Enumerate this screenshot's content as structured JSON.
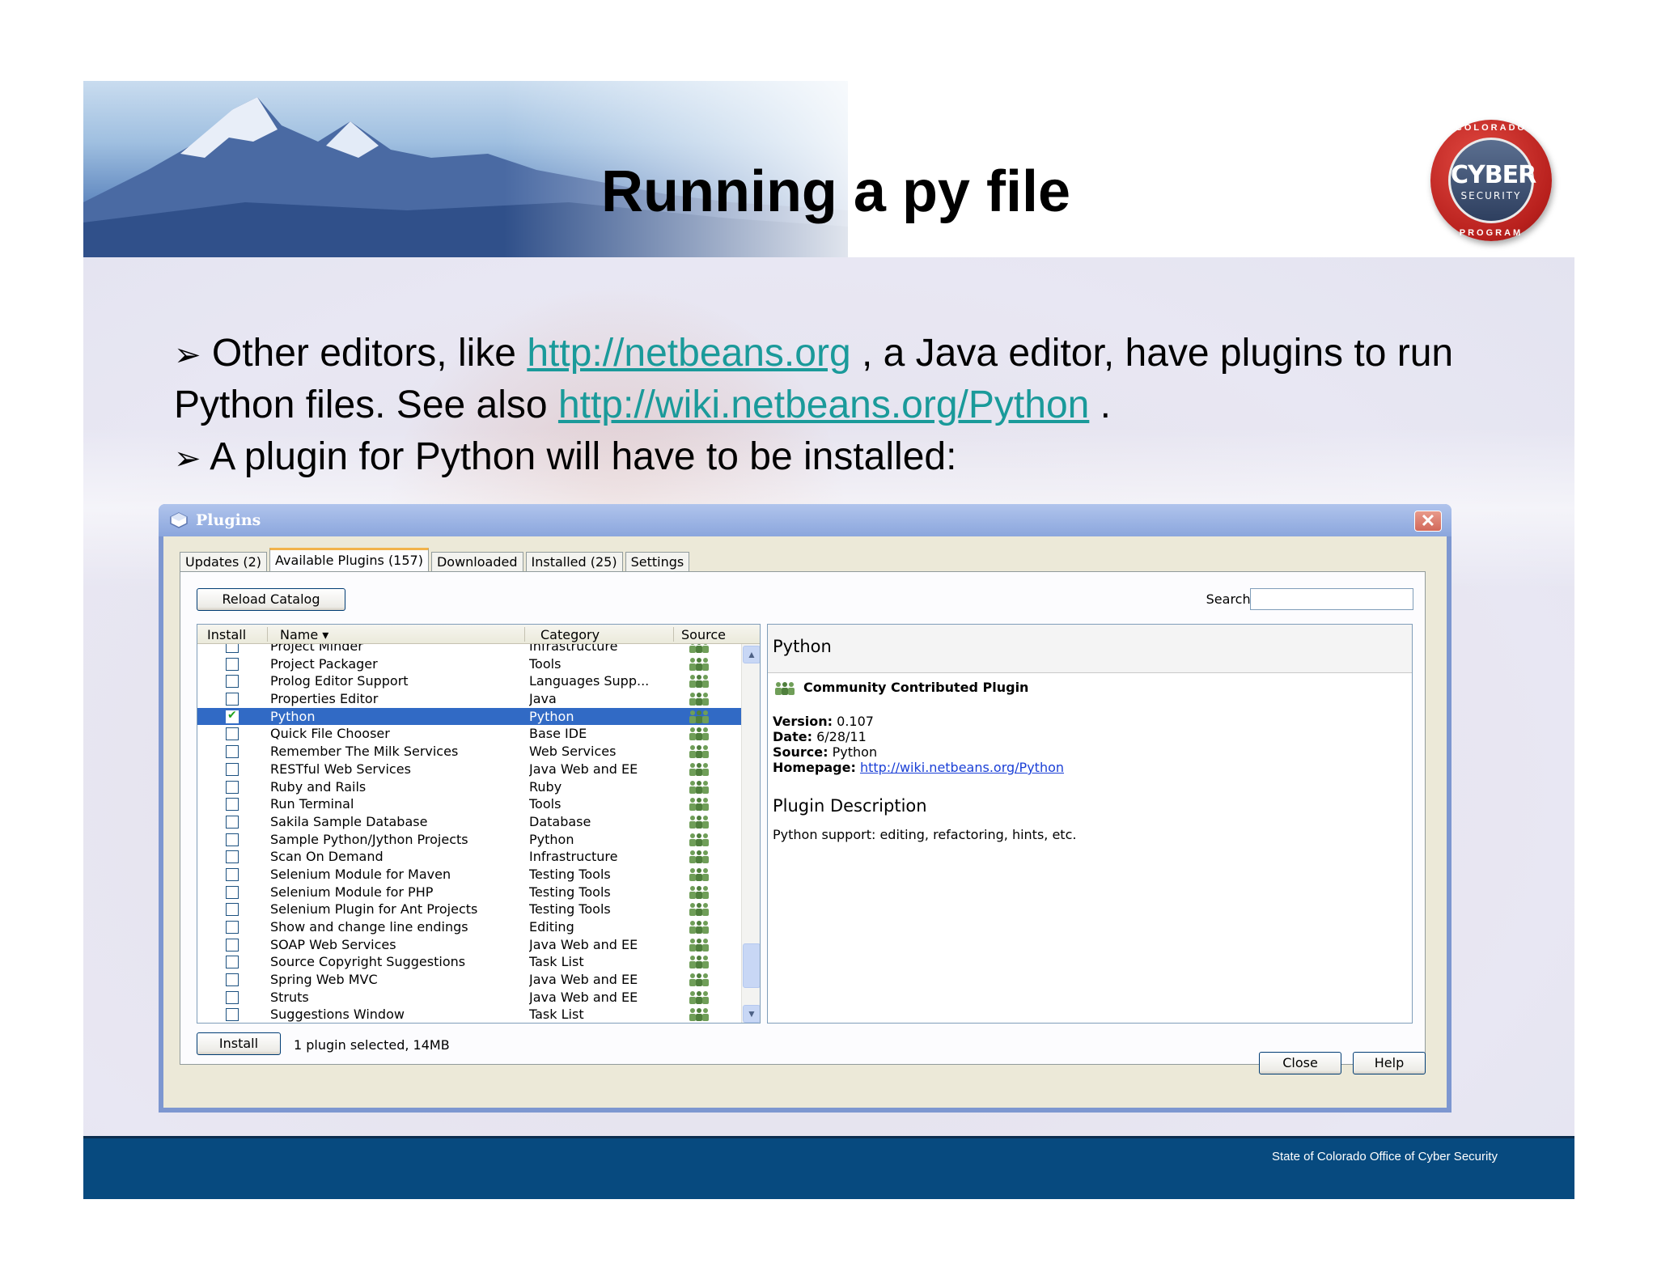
{
  "slide": {
    "title": "Running a py file",
    "bullet1": {
      "arrow": "➢",
      "text_a": " Other editors, like ",
      "link_a": "http://netbeans.org",
      "text_b": " , a Java editor, have plugins to run Python files. See also ",
      "link_b": "http://wiki.netbeans.org/Python",
      "text_c": " ."
    },
    "bullet2": {
      "arrow": "➢",
      "text": " A plugin for Python will have to be installed:"
    },
    "footer": "State of Colorado Office of Cyber Security",
    "logo": {
      "top_text": "COLORADO",
      "main_text": "CYBER",
      "sub_text": "SECURITY",
      "bottom_text": "PROGRAM"
    }
  },
  "dialog": {
    "title": "Plugins",
    "close_glyph": "✕",
    "tabs": [
      {
        "label": "Updates (2)",
        "active": false
      },
      {
        "label": "Available Plugins (157)",
        "active": true
      },
      {
        "label": "Downloaded",
        "active": false
      },
      {
        "label": "Installed (25)",
        "active": false
      },
      {
        "label": "Settings",
        "active": false
      }
    ],
    "reload_label": "Reload Catalog",
    "search_label": "Search:",
    "search_value": "",
    "columns": {
      "install": "Install",
      "name": "Name ▾",
      "category": "Category",
      "source": "Source"
    },
    "rows": [
      {
        "name": "Project Minder",
        "category": "Infrastructure",
        "checked": false,
        "selected": false
      },
      {
        "name": "Project Packager",
        "category": "Tools",
        "checked": false,
        "selected": false
      },
      {
        "name": "Prolog Editor Support",
        "category": "Languages Supp...",
        "checked": false,
        "selected": false
      },
      {
        "name": "Properties Editor",
        "category": "Java",
        "checked": false,
        "selected": false
      },
      {
        "name": "Python",
        "category": "Python",
        "checked": true,
        "selected": true
      },
      {
        "name": "Quick File Chooser",
        "category": "Base IDE",
        "checked": false,
        "selected": false
      },
      {
        "name": "Remember The Milk Services",
        "category": "Web Services",
        "checked": false,
        "selected": false
      },
      {
        "name": "RESTful Web Services",
        "category": "Java Web and EE",
        "checked": false,
        "selected": false
      },
      {
        "name": "Ruby and Rails",
        "category": "Ruby",
        "checked": false,
        "selected": false
      },
      {
        "name": "Run Terminal",
        "category": "Tools",
        "checked": false,
        "selected": false
      },
      {
        "name": "Sakila Sample Database",
        "category": "Database",
        "checked": false,
        "selected": false
      },
      {
        "name": "Sample Python/Jython Projects",
        "category": "Python",
        "checked": false,
        "selected": false
      },
      {
        "name": "Scan On Demand",
        "category": "Infrastructure",
        "checked": false,
        "selected": false
      },
      {
        "name": "Selenium Module for Maven",
        "category": "Testing Tools",
        "checked": false,
        "selected": false
      },
      {
        "name": "Selenium Module for PHP",
        "category": "Testing Tools",
        "checked": false,
        "selected": false
      },
      {
        "name": "Selenium Plugin for Ant Projects",
        "category": "Testing Tools",
        "checked": false,
        "selected": false
      },
      {
        "name": "Show and change line endings",
        "category": "Editing",
        "checked": false,
        "selected": false
      },
      {
        "name": "SOAP Web Services",
        "category": "Java Web and EE",
        "checked": false,
        "selected": false
      },
      {
        "name": "Source Copyright Suggestions",
        "category": "Task List",
        "checked": false,
        "selected": false
      },
      {
        "name": "Spring Web MVC",
        "category": "Java Web and EE",
        "checked": false,
        "selected": false
      },
      {
        "name": "Struts",
        "category": "Java Web and EE",
        "checked": false,
        "selected": false
      },
      {
        "name": "Suggestions Window",
        "category": "Task List",
        "checked": false,
        "selected": false
      }
    ],
    "details": {
      "plugin_name": "Python",
      "community": "Community Contributed Plugin",
      "version_label": "Version:",
      "version": "0.107",
      "date_label": "Date:",
      "date": "6/28/11",
      "source_label": "Source:",
      "source": "Python",
      "homepage_label": "Homepage:",
      "homepage": "http://wiki.netbeans.org/Python",
      "description_title": "Plugin Description",
      "description": "Python support: editing, refactoring, hints, etc."
    },
    "install_label": "Install",
    "status_text": "1 plugin selected, 14MB",
    "close_label": "Close",
    "help_label": "Help"
  }
}
